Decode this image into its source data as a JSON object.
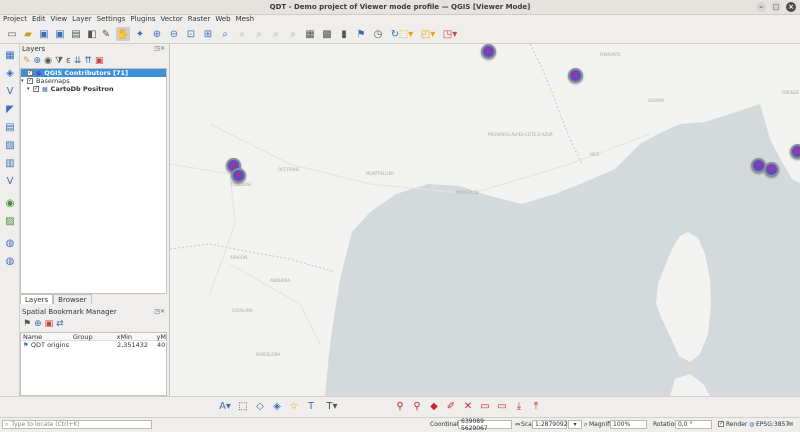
{
  "window": {
    "title": "QDT - Demo project of Viewer mode  profile — QGIS [Viewer Mode]"
  },
  "menubar": [
    "Project",
    "Edit",
    "View",
    "Layer",
    "Settings",
    "Plugins",
    "Vector",
    "Raster",
    "Web",
    "Mesh"
  ],
  "layers_panel": {
    "title": "Layers",
    "layers": [
      {
        "label": "QGIS Contributors [71]",
        "checked": true,
        "selected": true
      },
      {
        "label": "Basemaps",
        "checked": true,
        "group": true
      },
      {
        "label": "CartoDb Positron",
        "checked": true
      }
    ],
    "tabs": [
      "Layers",
      "Browser"
    ]
  },
  "bookmarks_panel": {
    "title": "Spatial Bookmark Manager",
    "columns": [
      "Name",
      "Group",
      "xMin",
      "yM"
    ],
    "rows": [
      {
        "name": "QDT origins",
        "group": "",
        "xmin": "2,351432",
        "ymin": "40"
      }
    ]
  },
  "map": {
    "labels": [
      "PIEMONTE",
      "PROVENCE-ALPES-CÔTE D'AZUR",
      "OCCITANIE",
      "ARAGÓN",
      "CATALUÑA",
      "LIGURIA",
      "MONTPELLIER",
      "NICE",
      "MARSEILLE",
      "TOULOUSE",
      "ANDORRA",
      "BARCELONA",
      "FIRENZE"
    ]
  },
  "statusbar": {
    "locate_placeholder": "Type to locate (Ctrl+K)",
    "coordinate_label": "Coordinate",
    "coordinate_value": "639089 5629067",
    "scale_label": "Scale",
    "scale_value": "1:2879092",
    "magnifier_label": "Magnifier",
    "magnifier_value": "100%",
    "rotation_label": "Rotation",
    "rotation_value": "0,0 °",
    "render_label": "Render",
    "crs_label": "EPSG:3857"
  },
  "colors": {
    "selection": "#3d8fd6",
    "marker_fill": "#5a4ec8",
    "marker_cross": "#d8256a",
    "sea": "#d4dadc",
    "land": "#f3f3f1"
  }
}
